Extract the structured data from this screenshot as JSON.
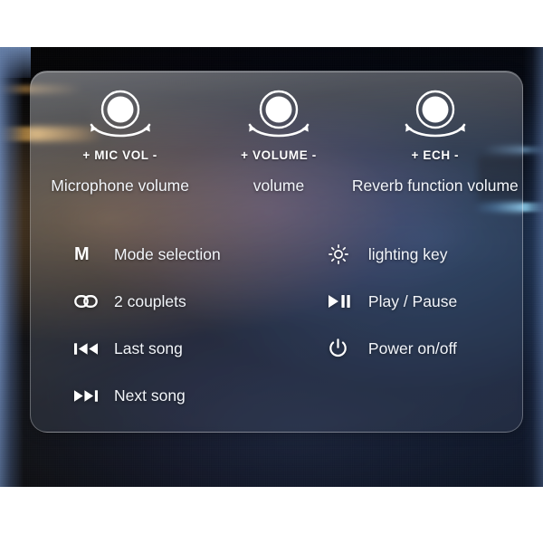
{
  "knobs": [
    {
      "icon": "rotary-knob-icon",
      "code": "+ MIC VOL -",
      "desc": "Microphone volume"
    },
    {
      "icon": "rotary-knob-icon",
      "code": "+ VOLUME -",
      "desc": "volume"
    },
    {
      "icon": "rotary-knob-icon",
      "code": "+ ECH -",
      "desc": "Reverb function volume"
    }
  ],
  "functions_left": [
    {
      "icon": "mode-m-icon",
      "label": "Mode selection"
    },
    {
      "icon": "link-chain-icon",
      "label": "2 couplets"
    },
    {
      "icon": "previous-track-icon",
      "label": "Last song"
    },
    {
      "icon": "next-track-icon",
      "label": "Next song"
    }
  ],
  "functions_right": [
    {
      "icon": "brightness-sun-icon",
      "label": "lighting key"
    },
    {
      "icon": "play-pause-icon",
      "label": "Play / Pause"
    },
    {
      "icon": "power-icon",
      "label": "Power on/off"
    }
  ],
  "colors": {
    "text": "#f2f5fa",
    "icon": "#ffffff",
    "panel_tint": "#cdd8ea",
    "background_top_band": "#ffffff",
    "background_dark": "#262b3a",
    "accent_warm": "#e0aa56",
    "accent_cyan": "#96deff",
    "edge_blue": "#6e8cbe"
  }
}
